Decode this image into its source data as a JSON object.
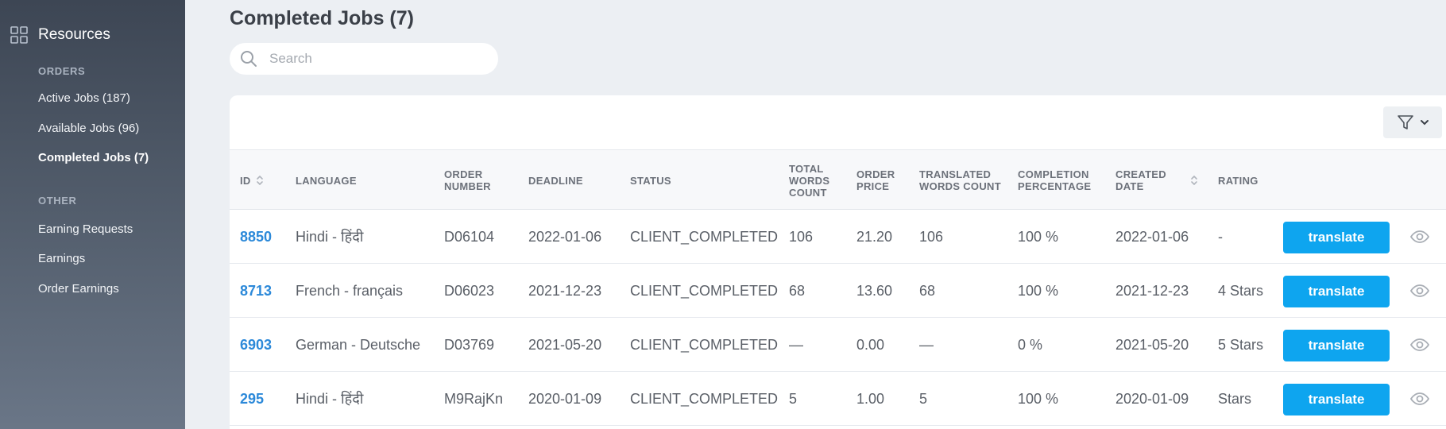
{
  "sidebar": {
    "brand_label": "Resources",
    "sections": [
      {
        "title": "ORDERS",
        "items": [
          {
            "label": "Active Jobs (187)",
            "active": false
          },
          {
            "label": "Available Jobs (96)",
            "active": false
          },
          {
            "label": "Completed Jobs (7)",
            "active": true
          }
        ]
      },
      {
        "title": "OTHER",
        "items": [
          {
            "label": "Earning Requests",
            "active": false
          },
          {
            "label": "Earnings",
            "active": false
          },
          {
            "label": "Order Earnings",
            "active": false
          }
        ]
      }
    ]
  },
  "page": {
    "title": "Completed Jobs (7)"
  },
  "search": {
    "placeholder": "Search",
    "value": ""
  },
  "table": {
    "headers": {
      "id": "ID",
      "language": "LANGUAGE",
      "order_number": "ORDER NUMBER",
      "deadline": "DEADLINE",
      "status": "STATUS",
      "total_words": "TOTAL WORDS COUNT",
      "order_price": "ORDER PRICE",
      "translated_words": "TRANSLATED WORDS COUNT",
      "completion": "COMPLETION PERCENTAGE",
      "created_date": "CREATED DATE",
      "rating": "RATING"
    },
    "action_label": "translate",
    "rows": [
      {
        "id": "8850",
        "language": "Hindi - हिंदी",
        "order_number": "D06104",
        "deadline": "2022-01-06",
        "status": "CLIENT_COMPLETED",
        "total_words": "106",
        "order_price": "21.20",
        "translated_words": "106",
        "completion": "100 %",
        "created_date": "2022-01-06",
        "rating": "-"
      },
      {
        "id": "8713",
        "language": "French - français",
        "order_number": "D06023",
        "deadline": "2021-12-23",
        "status": "CLIENT_COMPLETED",
        "total_words": "68",
        "order_price": "13.60",
        "translated_words": "68",
        "completion": "100 %",
        "created_date": "2021-12-23",
        "rating": "4 Stars"
      },
      {
        "id": "6903",
        "language": "German - Deutsche",
        "order_number": "D03769",
        "deadline": "2021-05-20",
        "status": "CLIENT_COMPLETED",
        "total_words": "—",
        "order_price": "0.00",
        "translated_words": "—",
        "completion": "0 %",
        "created_date": "2021-05-20",
        "rating": "5 Stars"
      },
      {
        "id": "295",
        "language": "Hindi - हिंदी",
        "order_number": "M9RajKn",
        "deadline": "2020-01-09",
        "status": "CLIENT_COMPLETED",
        "total_words": "5",
        "order_price": "1.00",
        "translated_words": "5",
        "completion": "100 %",
        "created_date": "2020-01-09",
        "rating": "Stars"
      }
    ]
  },
  "colors": {
    "accent": "#0ea5ef",
    "link": "#2c89d9",
    "sidebar_top": "#3d4654",
    "sidebar_bottom": "#6a7687"
  }
}
